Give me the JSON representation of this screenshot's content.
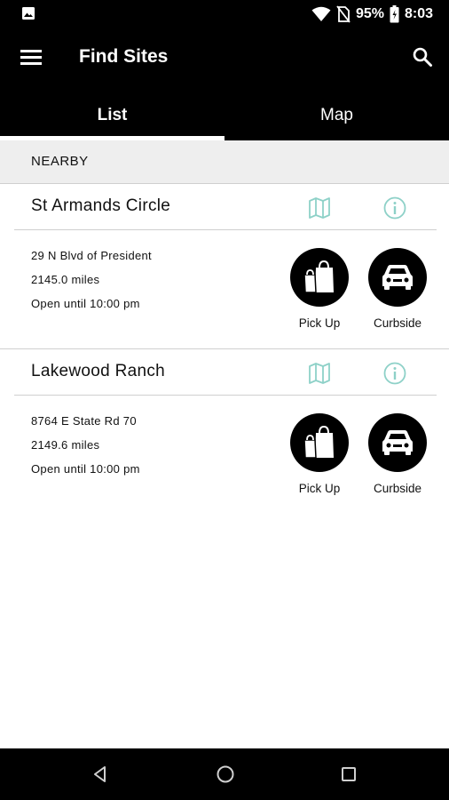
{
  "status_bar": {
    "battery": "95%",
    "time": "8:03",
    "icons": [
      "gallery-icon",
      "wifi-icon",
      "no-sim-icon",
      "battery-icon"
    ]
  },
  "app_bar": {
    "title": "Find Sites",
    "menu_icon": "hamburger-menu-icon",
    "search_icon": "search-icon"
  },
  "tabs": [
    {
      "label": "List",
      "selected": true
    },
    {
      "label": "Map",
      "selected": false
    }
  ],
  "section": {
    "title": "NEARBY"
  },
  "sites": [
    {
      "name": "St Armands Circle",
      "address": "29 N Blvd of President",
      "distance": "2145.0 miles",
      "hours": "Open until 10:00 pm",
      "pickup_label": "Pick Up",
      "curbside_label": "Curbside"
    },
    {
      "name": "Lakewood Ranch",
      "address": "8764 E State Rd 70",
      "distance": "2149.6 miles",
      "hours": "Open until 10:00 pm",
      "pickup_label": "Pick Up",
      "curbside_label": "Curbside"
    }
  ],
  "colors": {
    "bar_background": "#000000",
    "accent_icon": "#8ed1c8",
    "section_background": "#eeeeee",
    "divider": "#cfcfcf"
  },
  "nav_bar": {
    "icons": [
      "back-icon",
      "home-icon",
      "recent-apps-icon"
    ]
  }
}
